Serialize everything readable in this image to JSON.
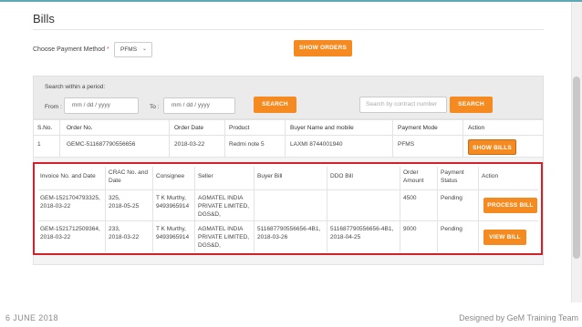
{
  "page": {
    "title": "Bills"
  },
  "payment_method": {
    "label": "Choose Payment Method",
    "required_mark": "*",
    "selected": "PFMS"
  },
  "buttons": {
    "show_orders": "SHOW ORDERS",
    "search": "SEARCH",
    "search2": "SEARCH",
    "show_bills": "SHOW BILLS",
    "process_bill": "PROCESS BILL",
    "view_bill": "VIEW BILL"
  },
  "search": {
    "period_label": "Search within a period:",
    "from_label": "From :",
    "to_label": "To :",
    "from_placeholder": "mm / dd / yyyy",
    "to_placeholder": "mm / dd / yyyy",
    "contract_placeholder": "Search by contract number"
  },
  "orders": {
    "headers": [
      "S.No.",
      "Order No.",
      "Order Date",
      "Product",
      "Buyer Name and mobile",
      "Payment Mode",
      "Action"
    ],
    "row": {
      "sno": "1",
      "order_no": "GEMC-511687790556656",
      "order_date": "2018-03-22",
      "product": "Redmi note 5",
      "buyer": "LAXMI 8744001940",
      "payment_mode": "PFMS"
    }
  },
  "bills": {
    "headers": {
      "invoice": "Invoice No. and Date",
      "crac": "CRAC No. and\nDate",
      "consignee": "Consignee",
      "seller": "Seller",
      "buyer_bill": "Buyer Bill",
      "ddo_bill": "DDO Bill",
      "order_amount": "Order\nAmount",
      "payment_status": "Payment\nStatus",
      "action": "Action"
    },
    "rows": [
      {
        "invoice": "GEM-1521704793325,\n2018-03-22",
        "crac": "325,\n2018-05-25",
        "consignee": "T K Murthy,\n9493965914",
        "seller": "AGMATEL INDIA\nPRIVATE LIMITED,\nDGS&D,",
        "buyer_bill": "",
        "ddo_bill": "",
        "order_amount": "4500",
        "payment_status": "Pending"
      },
      {
        "invoice": "GEM-1521712509364,\n2018-03-22",
        "crac": "233,\n2018-03-22",
        "consignee": "T K Murthy,\n9493965914",
        "seller": "AGMATEL INDIA\nPRIVATE LIMITED,\nDGS&D,",
        "buyer_bill": "511687790556656-4B1,\n2018-03-26",
        "ddo_bill": "511687790556656-4B1,\n2018-04-25",
        "order_amount": "9000",
        "payment_status": "Pending"
      }
    ]
  },
  "footer": {
    "date": "6 JUNE 2018",
    "credit": "Designed by GeM Training Team"
  },
  "colors": {
    "accent": "#f58b20",
    "highlight_border": "#d3202b",
    "panel_bg": "#ebebeb"
  },
  "icons": {
    "select_caret": "chevron-down-icon"
  }
}
